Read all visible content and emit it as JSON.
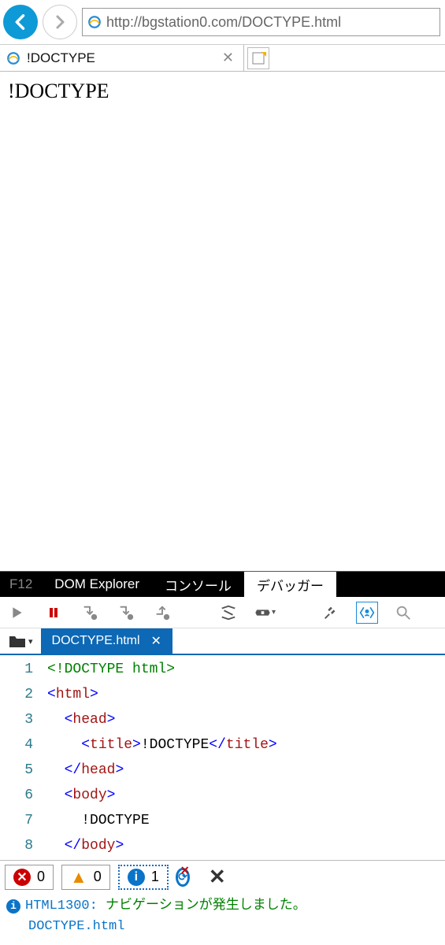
{
  "nav": {
    "url": "http://bgstation0.com/DOCTYPE.html"
  },
  "tab": {
    "title": "!DOCTYPE"
  },
  "page": {
    "heading": "!DOCTYPE"
  },
  "devtools": {
    "f12": "F12",
    "tabs": {
      "dom": "DOM Explorer",
      "console": "コンソール",
      "debugger": "デバッガー"
    },
    "file": "DOCTYPE.html",
    "code": [
      {
        "n": "1",
        "parts": [
          {
            "t": "<!DOCTYPE html>",
            "c": "c-doc"
          }
        ]
      },
      {
        "n": "2",
        "parts": [
          {
            "t": "<",
            "c": "c-ang"
          },
          {
            "t": "html",
            "c": "c-tag"
          },
          {
            "t": ">",
            "c": "c-ang"
          }
        ]
      },
      {
        "n": "3",
        "parts": [
          {
            "t": "  ",
            "c": "c-txt"
          },
          {
            "t": "<",
            "c": "c-ang"
          },
          {
            "t": "head",
            "c": "c-tag"
          },
          {
            "t": ">",
            "c": "c-ang"
          }
        ]
      },
      {
        "n": "4",
        "parts": [
          {
            "t": "    ",
            "c": "c-txt"
          },
          {
            "t": "<",
            "c": "c-ang"
          },
          {
            "t": "title",
            "c": "c-tag"
          },
          {
            "t": ">",
            "c": "c-ang"
          },
          {
            "t": "!DOCTYPE",
            "c": "c-txt"
          },
          {
            "t": "</",
            "c": "c-ang"
          },
          {
            "t": "title",
            "c": "c-tag"
          },
          {
            "t": ">",
            "c": "c-ang"
          }
        ]
      },
      {
        "n": "5",
        "parts": [
          {
            "t": "  ",
            "c": "c-txt"
          },
          {
            "t": "</",
            "c": "c-ang"
          },
          {
            "t": "head",
            "c": "c-tag"
          },
          {
            "t": ">",
            "c": "c-ang"
          }
        ]
      },
      {
        "n": "6",
        "parts": [
          {
            "t": "  ",
            "c": "c-txt"
          },
          {
            "t": "<",
            "c": "c-ang"
          },
          {
            "t": "body",
            "c": "c-tag"
          },
          {
            "t": ">",
            "c": "c-ang"
          }
        ]
      },
      {
        "n": "7",
        "parts": [
          {
            "t": "    !DOCTYPE",
            "c": "c-txt"
          }
        ]
      },
      {
        "n": "8",
        "parts": [
          {
            "t": "  ",
            "c": "c-txt"
          },
          {
            "t": "</",
            "c": "c-ang"
          },
          {
            "t": "body",
            "c": "c-tag"
          },
          {
            "t": ">",
            "c": "c-ang"
          }
        ]
      }
    ],
    "status": {
      "errors": "0",
      "warnings": "0",
      "info": "1"
    },
    "console": {
      "info": "i",
      "code": "HTML1300: ",
      "msg": "ナビゲーションが発生しました。",
      "file": "DOCTYPE.html"
    }
  }
}
